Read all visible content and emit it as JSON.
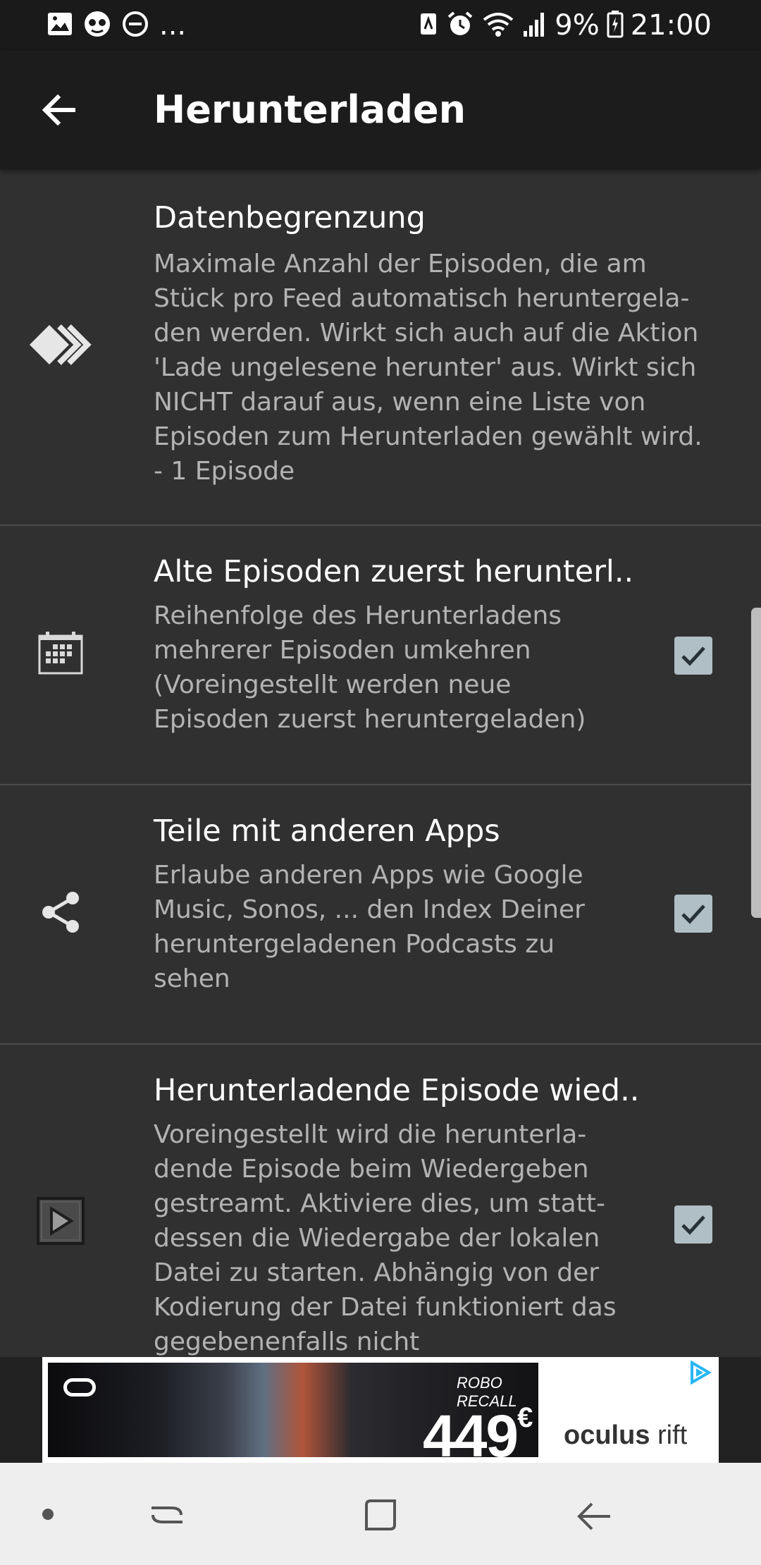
{
  "status_bar": {
    "battery_text": "9%",
    "time": "21:00",
    "more_indicator": "...",
    "left_icons": [
      "image-icon",
      "face-icon",
      "do-not-disturb-icon"
    ],
    "right_icons": [
      "nfc-icon",
      "alarm-icon",
      "wifi-icon",
      "signal-icon",
      "battery-charging-icon"
    ]
  },
  "toolbar": {
    "back_icon": "arrow-back-icon",
    "title": "Herunterladen"
  },
  "preferences": [
    {
      "icon": "fast-forward-icon",
      "title": "Datenbegrenzung",
      "summary_lines": [
        "Maximale Anzahl der Episoden, die am",
        "Stück pro Feed automatisch heruntergela-",
        "den werden. Wirkt sich auch auf die Aktion",
        "'Lade ungelesene herunter' aus. Wirkt sich",
        "NICHT darauf aus, wenn eine Liste von",
        "Episoden zum Herunterladen gewählt wird.",
        "- 1 Episode"
      ],
      "has_checkbox": false
    },
    {
      "icon": "calendar-icon",
      "title": "Alte Episoden zuerst herunterl..",
      "summary_lines": [
        "Reihenfolge des Herunterladens",
        "mehrerer Episoden umkehren",
        "(Voreingestellt werden neue",
        "Episoden zuerst heruntergeladen)"
      ],
      "has_checkbox": true,
      "checked": true
    },
    {
      "icon": "share-icon",
      "title": "Teile mit anderen Apps",
      "summary_lines": [
        "Erlaube anderen Apps wie Google",
        "Music, Sonos, ... den Index Deiner",
        "heruntergeladenen Podcasts zu",
        "sehen"
      ],
      "has_checkbox": true,
      "checked": true
    },
    {
      "icon": "play-box-icon",
      "title": "Herunterladende Episode wied..",
      "summary_lines": [
        "Voreingestellt wird die herunterla-",
        "dende Episode beim Wiedergeben",
        "gestreamt. Aktiviere dies, um statt-",
        "dessen die Wiedergabe der lokalen",
        "Datei zu starten. Abhängig von der",
        "Kodierung der Datei funktioniert das",
        "gegebenenfalls nicht"
      ],
      "has_checkbox": true,
      "checked": true
    }
  ],
  "ad": {
    "tagline": "ROBO RECALL",
    "price": "449",
    "currency": "€",
    "brand_bold": "oculus",
    "brand_light": "rift",
    "adchoices_icon": "ad-choices-icon"
  },
  "nav_bar": {
    "icons": [
      "nav-dot-icon",
      "recent-apps-icon",
      "home-icon",
      "back-icon"
    ]
  },
  "colors": {
    "background": "#303030",
    "toolbar": "#1c1c1c",
    "status_bar": "#1a1a1a",
    "summary_text": "#b3b3b3",
    "checkbox": "#b0bec5",
    "divider": "#4d4d4d",
    "nav_bar": "#eeeeee"
  }
}
